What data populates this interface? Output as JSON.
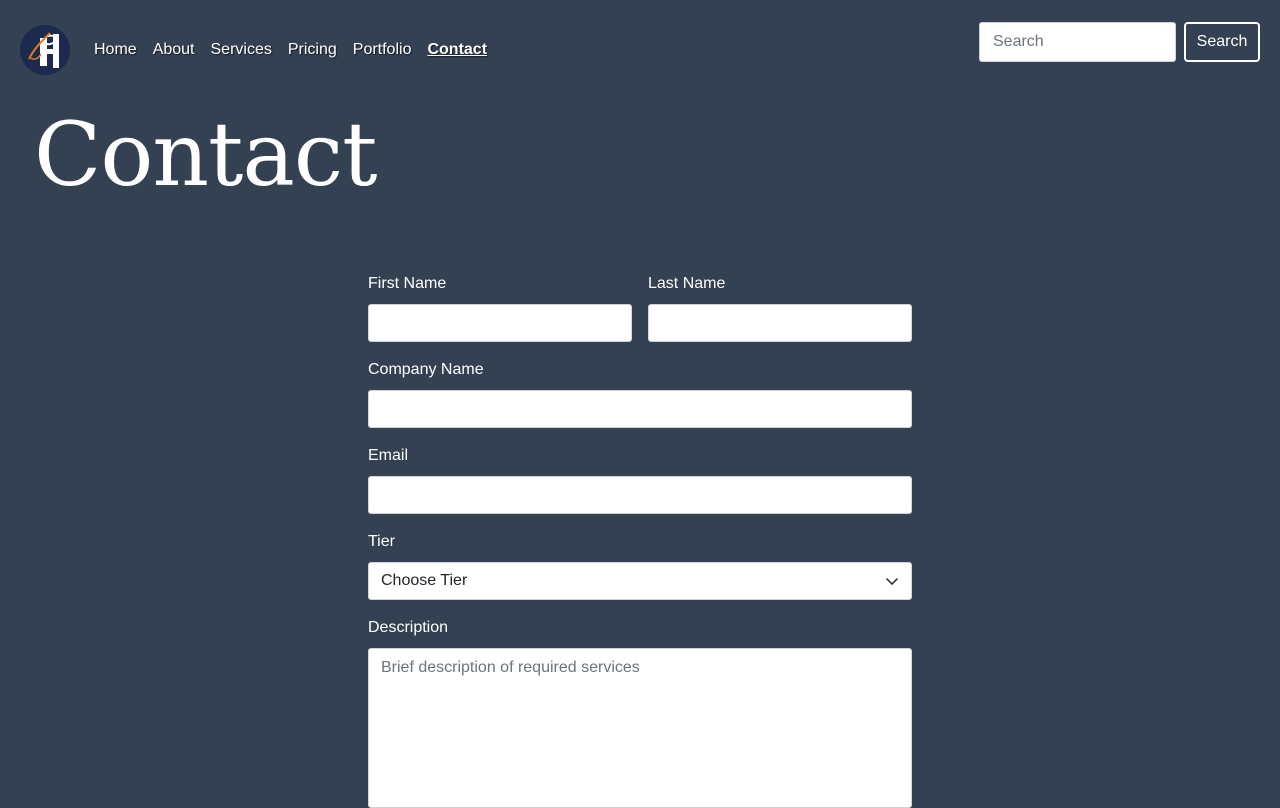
{
  "nav": {
    "logo_icon": "logo-icon",
    "links": [
      "Home",
      "About",
      "Services",
      "Pricing",
      "Portfolio",
      "Contact"
    ],
    "active": "Contact"
  },
  "search": {
    "placeholder": "Search",
    "value": "",
    "button_label": "Search"
  },
  "page": {
    "title": "Contact"
  },
  "form": {
    "first_name": {
      "label": "First Name",
      "value": ""
    },
    "last_name": {
      "label": "Last Name",
      "value": ""
    },
    "company_name": {
      "label": "Company Name",
      "value": ""
    },
    "email": {
      "label": "Email",
      "value": ""
    },
    "tier": {
      "label": "Tier",
      "selected": "Choose Tier",
      "icon": "chevron-down-icon"
    },
    "description": {
      "label": "Description",
      "placeholder": "Brief description of required services",
      "value": ""
    }
  },
  "colors": {
    "background": "#334152",
    "text": "#ffffff",
    "logo_navy": "#1b2a4e",
    "logo_orange": "#e07a1f"
  }
}
